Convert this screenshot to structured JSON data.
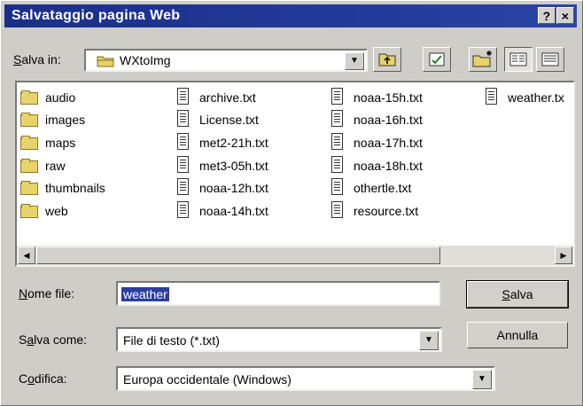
{
  "window": {
    "title": "Salvataggio pagina Web",
    "help_label": "?",
    "close_label": "×"
  },
  "location": {
    "label_prefix": "",
    "label_underlined": "S",
    "label_rest": "alva in:",
    "value": "WXtoImg",
    "toolbar_icons": [
      "up-folder-icon",
      "desktop-icon",
      "new-folder-icon",
      "list-view-icon",
      "details-view-icon"
    ]
  },
  "files": {
    "columns": [
      [
        {
          "name": "audio",
          "type": "folder"
        },
        {
          "name": "images",
          "type": "folder"
        },
        {
          "name": "maps",
          "type": "folder"
        },
        {
          "name": "raw",
          "type": "folder"
        },
        {
          "name": "thumbnails",
          "type": "folder"
        },
        {
          "name": "web",
          "type": "folder"
        }
      ],
      [
        {
          "name": "archive.txt",
          "type": "file"
        },
        {
          "name": "License.txt",
          "type": "file"
        },
        {
          "name": "met2-21h.txt",
          "type": "file"
        },
        {
          "name": "met3-05h.txt",
          "type": "file"
        },
        {
          "name": "noaa-12h.txt",
          "type": "file"
        },
        {
          "name": "noaa-14h.txt",
          "type": "file"
        }
      ],
      [
        {
          "name": "noaa-15h.txt",
          "type": "file"
        },
        {
          "name": "noaa-16h.txt",
          "type": "file"
        },
        {
          "name": "noaa-17h.txt",
          "type": "file"
        },
        {
          "name": "noaa-18h.txt",
          "type": "file"
        },
        {
          "name": "othertle.txt",
          "type": "file"
        },
        {
          "name": "resource.txt",
          "type": "file"
        }
      ],
      [
        {
          "name": "weather.tx",
          "type": "file"
        }
      ]
    ]
  },
  "form": {
    "filename": {
      "label_underlined": "N",
      "label_rest": "ome file:",
      "value": "weather"
    },
    "savetype": {
      "label_prefix": "S",
      "label_underlined": "a",
      "label_rest": "lva come:",
      "value": "File di testo (*.txt)"
    },
    "encoding": {
      "label_prefix": "C",
      "label_underlined": "o",
      "label_rest": "difica:",
      "value": "Europa occidentale (Windows)"
    }
  },
  "buttons": {
    "save_underlined": "S",
    "save_rest": "alva",
    "cancel": "Annulla"
  }
}
